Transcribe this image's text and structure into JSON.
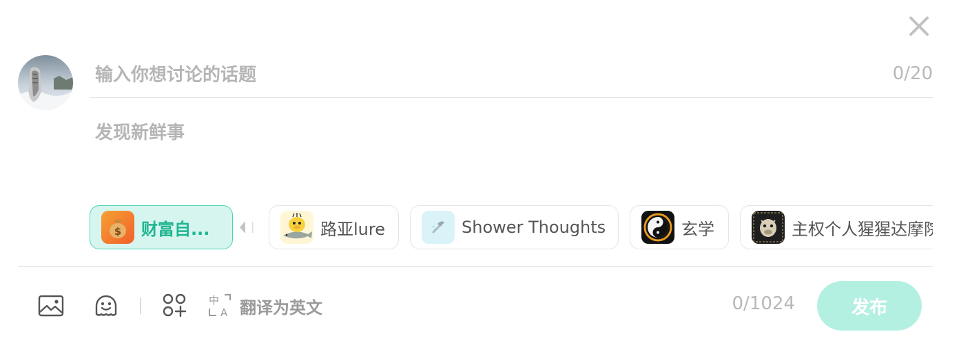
{
  "dialog": {
    "close_icon": "close-icon"
  },
  "topic": {
    "placeholder": "输入你想讨论的话题",
    "count": "0/20"
  },
  "content": {
    "placeholder": "发现新鲜事",
    "count": "0/1024"
  },
  "circles": [
    {
      "label": "财富自...",
      "icon": "money-bag-icon",
      "selected": true
    },
    {
      "label": "路亚lure",
      "icon": "duck-fish-icon",
      "selected": false
    },
    {
      "label": "Shower Thoughts",
      "icon": "shower-icon",
      "selected": false
    },
    {
      "label": "玄学",
      "icon": "yin-yang-icon",
      "selected": false
    },
    {
      "label": "主权个人猩猩达摩院",
      "icon": "ape-icon",
      "selected": false
    }
  ],
  "toolbar": {
    "image_icon": "image-icon",
    "emoji_icon": "emoji-icon",
    "apps_icon": "apps-icon",
    "translate_icon": "translate-icon",
    "translate_label": "翻译为英文"
  },
  "publish": {
    "label": "发布"
  },
  "colors": {
    "accent": "#1fb58f",
    "accent_light": "#d6f5ef",
    "publish_disabled": "#b4f0e2"
  }
}
